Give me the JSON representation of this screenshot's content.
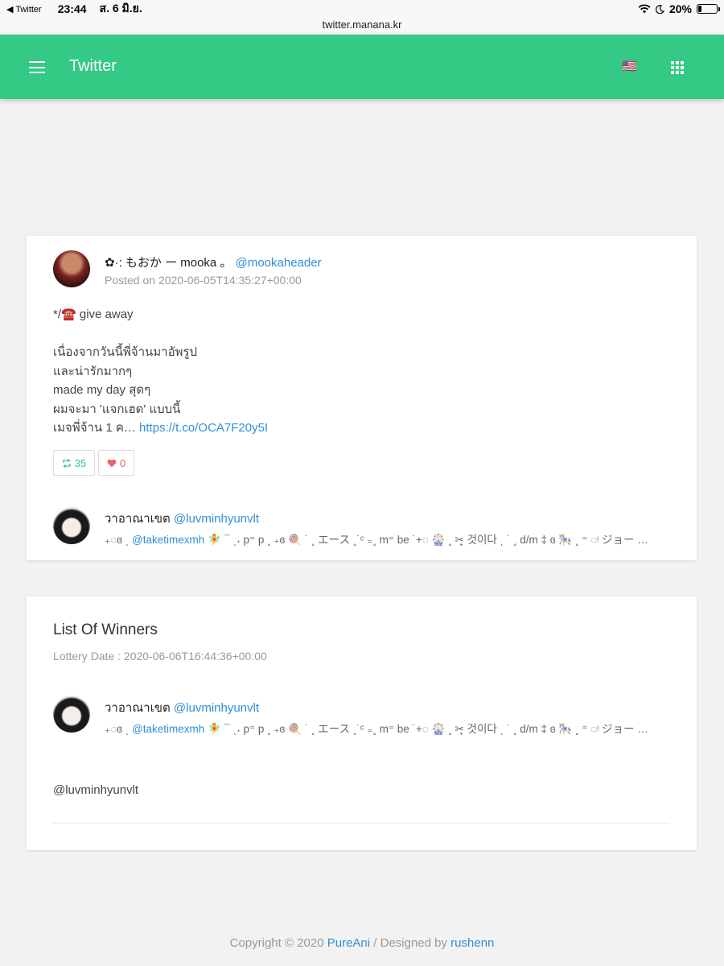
{
  "status_bar": {
    "back_label": "◀ Twitter",
    "time": "23:44",
    "date": "ส. 6 มิ.ย.",
    "battery": "20%",
    "battery_level": 0.2
  },
  "browser": {
    "url": "twitter.manana.kr"
  },
  "appbar": {
    "title": "Twitter",
    "color": "#34c985",
    "flag_emoji": "🇺🇸",
    "menu_icon": "hamburger-icon",
    "apps_icon": "grid-icon"
  },
  "tweet": {
    "author_name": "✿·: もおか ー mooka 。",
    "author_handle": "@mookaheader",
    "posted": "Posted on 2020-06-05T14:35:27+00:00",
    "text_lines": [
      "*/☎️ give away",
      "",
      "เนื่องจากวันนี้พี่จ้านมาอัพรูป",
      "และน่ารักมากๆ",
      "made my day สุดๆ",
      "ผมจะมา 'แจกเฮด' แบบนี้",
      "เมจพี่จ้าน 1 ค…"
    ],
    "link": "https://t.co/OCA7F20y5I",
    "retweets": "35",
    "likes": "0"
  },
  "user": {
    "name": "วาอาณาเขต",
    "handle": "@luvminhyunvlt",
    "bio_prefix": "₊◌ɞ ͺ ",
    "bio_handle": "@taketimexmh",
    "bio_rest": " 🧚 ¯ ͺ˖ p⁼ p ˳ ₊ɞ 🍭 ˙ ˳ エース ˳˙ᶜ ₌˳ m⁼ be ˙+◌ 🎡 ˳ ✂̟ 것이다 ͺ ˙ ˳ d/m ‡ ɞ 🎠 ˳ ⁼ ◌ᵎ ジョー …"
  },
  "winners": {
    "title": "List Of Winners",
    "lottery_date": "Lottery Date : 2020-06-06T16:44:36+00:00",
    "winner_handle": "@luvminhyunvlt"
  },
  "footer": {
    "prefix": "Copyright © 2020 ",
    "brand": "PureAni",
    "middle": " / Designed by ",
    "designer": "rushenn"
  }
}
